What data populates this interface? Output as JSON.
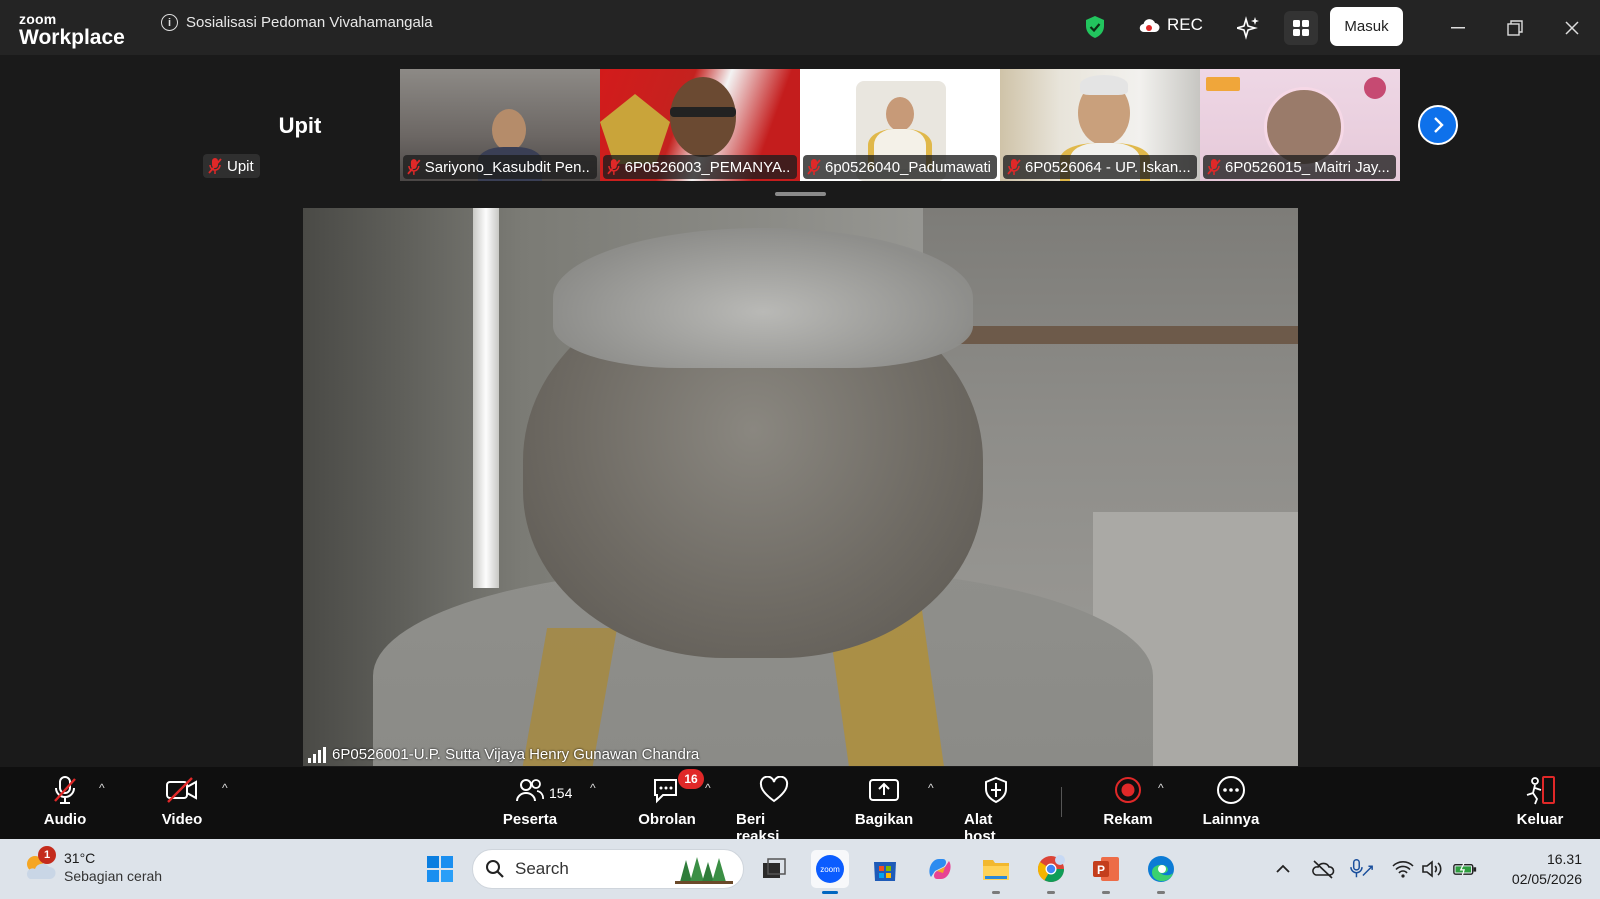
{
  "titlebar": {
    "brand_line1": "zoom",
    "brand_line2": "Workplace",
    "meeting_title": "Sosialisasi Pedoman Vivahamangala",
    "rec_label": "REC",
    "sign_in_label": "Masuk"
  },
  "gallery": {
    "active_speaker": "Upit",
    "active_speaker_label": "Upit",
    "participants": [
      {
        "name": "Sariyono_Kasubdit Pen..."
      },
      {
        "name": "6P0526003_PEMANYA..."
      },
      {
        "name": "6p0526040_Padumawati"
      },
      {
        "name": "6P0526064 - UP. Iskan..."
      },
      {
        "name": "6P0526015_ Maitri Jay..."
      }
    ],
    "next_page_icon": "chevron-right-icon"
  },
  "main_video": {
    "participant_name": "6P0526001-U.P. Sutta Vijaya Henry Gunawan Chandra"
  },
  "toolbar": {
    "audio": "Audio",
    "video": "Video",
    "participants": "Peserta",
    "participants_count": "154",
    "chat": "Obrolan",
    "chat_badge": "16",
    "reactions": "Beri reaksi",
    "share": "Bagikan",
    "host_tools": "Alat host",
    "record": "Rekam",
    "more": "Lainnya",
    "leave": "Keluar"
  },
  "taskbar": {
    "weather_temp": "31°C",
    "weather_cond": "Sebagian cerah",
    "weather_badge": "1",
    "search_placeholder": "Search",
    "time": "16.31",
    "date": "02/05/2026"
  },
  "colors": {
    "accent_blue": "#0e71eb",
    "mute_red": "#e02828",
    "shield_green": "#22c55e"
  }
}
